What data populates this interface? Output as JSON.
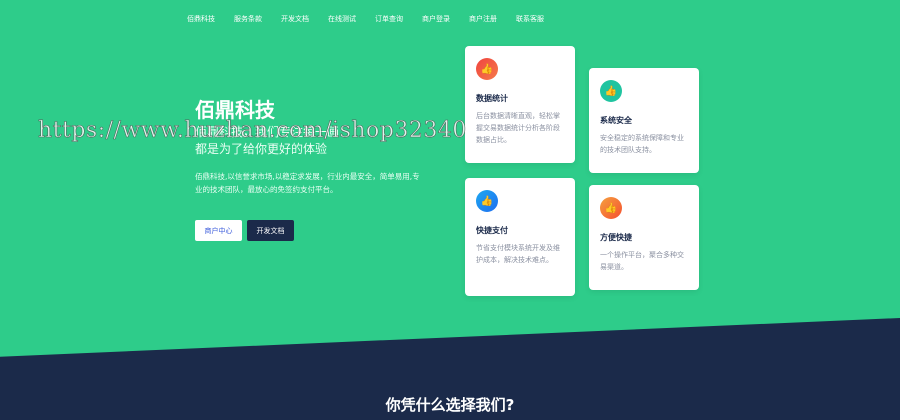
{
  "nav": [
    "佰鼎科技",
    "服务条款",
    "开发文档",
    "在线测试",
    "订单查询",
    "商户登录",
    "商户注册",
    "联系客服"
  ],
  "hero": {
    "title": "佰鼎科技",
    "subtitle_line1": "佰鼎科技，我们专注每一画",
    "subtitle_line2": "都是为了给你更好的体验",
    "description": "佰鼎科技,以信誉求市场,以稳定求发展，行业内最安全，简单易用,专业的技术团队，最放心的免签约支付平台。",
    "buttons": {
      "merchant_center": "商户中心",
      "dev_docs": "开发文档"
    }
  },
  "cards": [
    {
      "title": "数据统计",
      "desc": "后台数据清晰直观，轻松掌握交易数据统计分析各阶段数据占比。",
      "color": "#f0443f"
    },
    {
      "title": "系统安全",
      "desc": "安全稳定的系统保障和专业的技术团队支持。",
      "color": "#20c4a0"
    },
    {
      "title": "快捷支付",
      "desc": "节省支付模块系统开发及维护成本，解决技术难点。",
      "color": "#1e88f0"
    },
    {
      "title": "方便快捷",
      "desc": "一个操作平台，聚合多种交易渠道。",
      "color": "#f5702f"
    }
  ],
  "watermark": "https://www.huzhan.com/ishop32340",
  "section": {
    "title": "你凭什么选择我们?"
  }
}
